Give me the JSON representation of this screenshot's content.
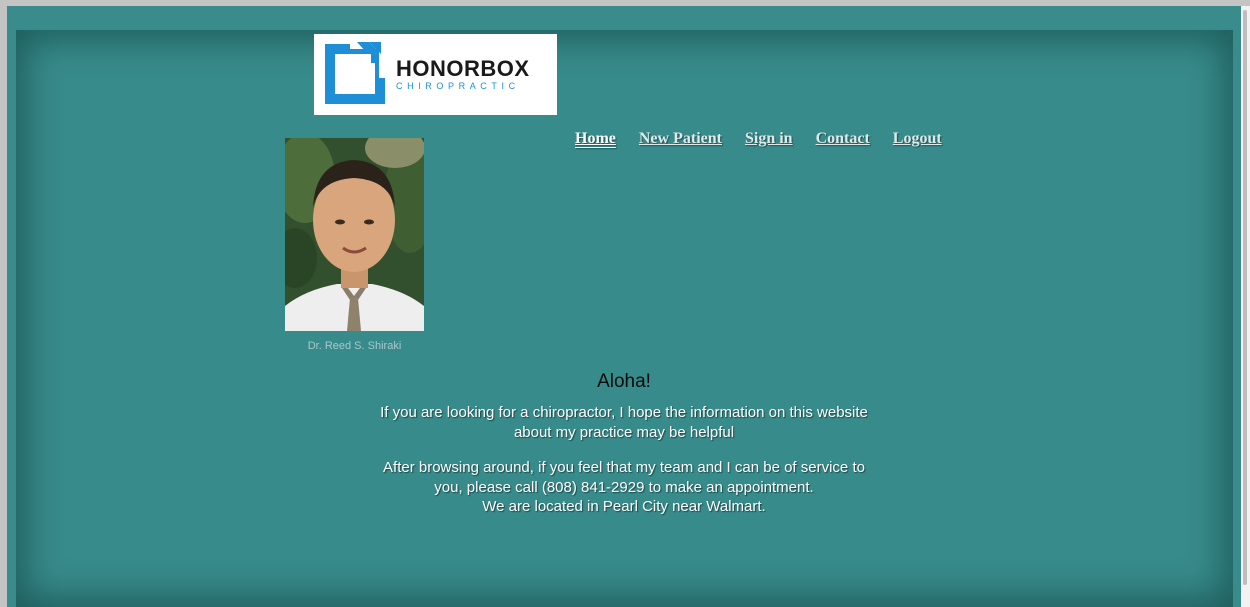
{
  "logo": {
    "word": "HONORBOX",
    "sub": "CHIROPRACTIC",
    "brand_color": "#1e8fd6"
  },
  "nav": {
    "items": [
      {
        "label": "Home",
        "active": true
      },
      {
        "label": "New Patient"
      },
      {
        "label": "Sign in"
      },
      {
        "label": "Contact"
      },
      {
        "label": "Logout"
      }
    ]
  },
  "profile": {
    "caption": "Dr. Reed S. Shiraki"
  },
  "main": {
    "greeting": "Aloha!",
    "para1": {
      "line1": "If you are looking for a chiropractor, I hope the information on this website",
      "line2": "about my practice may be helpful"
    },
    "para2": {
      "line1": "After browsing around, if you feel that my team and I can be of service to",
      "line2": "you, please call (808) 841-2929 to make an appointment.",
      "line3": "We are located in Pearl City near Walmart."
    }
  },
  "colors": {
    "page_bg": "#3a8c8c",
    "panel_bg": "#388b8b"
  }
}
